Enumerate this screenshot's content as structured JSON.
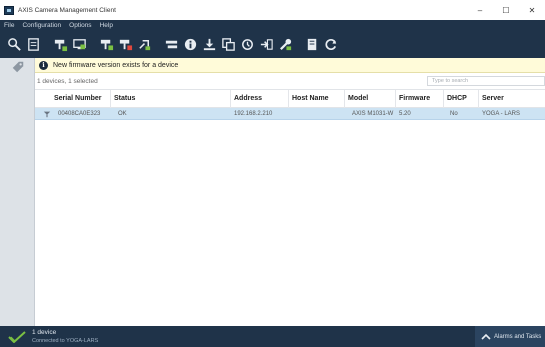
{
  "window": {
    "title": "AXIS Camera Management Client",
    "minimize_glyph": "–",
    "maximize_glyph": "☐",
    "close_glyph": "✕"
  },
  "menu": [
    "File",
    "Configuration",
    "Options",
    "Help"
  ],
  "toolbar": {
    "buttons": [
      "search-network",
      "report",
      "add-device",
      "assign-ip",
      "add-device-green",
      "remove-device",
      "link",
      "upgrade-firmware",
      "info",
      "install",
      "copy-config",
      "restore",
      "forward",
      "tools",
      "page",
      "refresh"
    ]
  },
  "notification": {
    "icon": "info-icon",
    "text": "New firmware version exists for a device"
  },
  "list": {
    "count_text": "1 devices, 1 selected",
    "search_placeholder": "Type to search"
  },
  "table": {
    "columns": [
      "Serial Number",
      "Status",
      "Address",
      "Host Name",
      "Model",
      "Firmware",
      "DHCP",
      "Server"
    ],
    "rows": [
      {
        "serial": "00408CA0E323",
        "status": "OK",
        "address": "192.168.2.210",
        "hostname": "",
        "model": "AXIS M1031-W",
        "firmware": "5.20",
        "dhcp": "No",
        "server": "YOGA - LARS"
      }
    ]
  },
  "statusbar": {
    "line1": "1 device",
    "line2": "Connected to YOGA-LARS",
    "alarms_label": "Alarms and Tasks"
  },
  "colors": {
    "chrome": "#1f3349",
    "selected_row": "#cde3f3",
    "notification_bg": "#fffbd9",
    "accent_green": "#7bc043"
  }
}
